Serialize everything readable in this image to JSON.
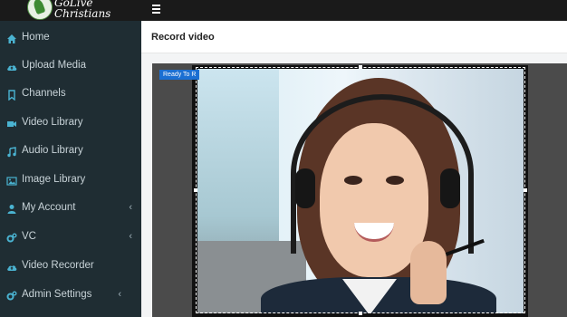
{
  "brand": {
    "line1": "GoLive",
    "line2": "Christians",
    "colors": {
      "sidebar": "#1f2d33",
      "topbar": "#1a1a1a"
    }
  },
  "topbar": {
    "menu_icon": "hamburger-icon"
  },
  "sidebar": {
    "items": [
      {
        "label": "Home",
        "icon": "home-icon"
      },
      {
        "label": "Upload Media",
        "icon": "cloud-upload-icon"
      },
      {
        "label": "Channels",
        "icon": "bookmark-icon"
      },
      {
        "label": "Video Library",
        "icon": "video-camera-icon"
      },
      {
        "label": "Audio Library",
        "icon": "music-note-icon"
      },
      {
        "label": "Image Library",
        "icon": "image-icon"
      },
      {
        "label": "My Account",
        "icon": "user-icon",
        "has_submenu": true
      },
      {
        "label": "VC",
        "icon": "gears-icon",
        "has_submenu": true
      },
      {
        "label": "Video Recorder",
        "icon": "cloud-upload-icon"
      },
      {
        "label": "Admin Settings",
        "icon": "gears-icon",
        "has_submenu": true
      }
    ],
    "chevron": "‹"
  },
  "page": {
    "title": "Record video"
  },
  "recorder": {
    "status_badge": "Ready To R",
    "badge_color": "#1b6fd2"
  }
}
